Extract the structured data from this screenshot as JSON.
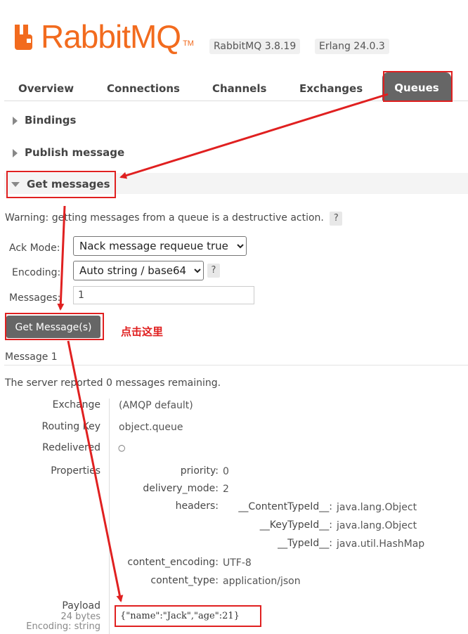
{
  "header": {
    "logo_text": "RabbitMQ",
    "logo_tm": "TM",
    "brand_color": "#f26b1e",
    "rabbit_version": "RabbitMQ 3.8.19",
    "erlang_version": "Erlang 24.0.3"
  },
  "tabs": [
    {
      "label": "Overview"
    },
    {
      "label": "Connections"
    },
    {
      "label": "Channels"
    },
    {
      "label": "Exchanges"
    },
    {
      "label": "Queues",
      "active": true
    }
  ],
  "sections": {
    "bindings": "Bindings",
    "publish": "Publish message",
    "get": "Get messages"
  },
  "get_form": {
    "warning": "Warning: getting messages from a queue is a destructive action.",
    "help": "?",
    "ack_mode_label": "Ack Mode:",
    "ack_mode_value": "Nack message requeue true",
    "encoding_label": "Encoding:",
    "encoding_value": "Auto string / base64",
    "messages_label": "Messages:",
    "messages_value": "1",
    "button": "Get Message(s)",
    "annotation": "点击这里"
  },
  "message": {
    "title": "Message 1",
    "remaining": "The server reported 0 messages remaining.",
    "exchange_label": "Exchange",
    "exchange_value": "(AMQP default)",
    "routing_key_label": "Routing Key",
    "routing_key_value": "object.queue",
    "redelivered_label": "Redelivered",
    "redelivered_value": "○",
    "properties_label": "Properties",
    "properties": {
      "priority_label": "priority:",
      "priority_value": "0",
      "delivery_mode_label": "delivery_mode:",
      "delivery_mode_value": "2",
      "headers_label": "headers:",
      "header_content_type_label": "__ContentTypeId__:",
      "header_content_type_value": "java.lang.Object",
      "header_key_type_label": "__KeyTypeId__:",
      "header_key_type_value": "java.lang.Object",
      "header_type_label": "__TypeId__:",
      "header_type_value": "java.util.HashMap",
      "content_encoding_label": "content_encoding:",
      "content_encoding_value": "UTF-8",
      "content_type_label": "content_type:",
      "content_type_value": "application/json"
    },
    "payload_label": "Payload",
    "payload_size": "24 bytes",
    "payload_encoding": "Encoding: string",
    "payload_value": "{\"name\":\"Jack\",\"age\":21}"
  },
  "colors": {
    "annotation_red": "#e02020",
    "tab_active_bg": "#666666"
  }
}
